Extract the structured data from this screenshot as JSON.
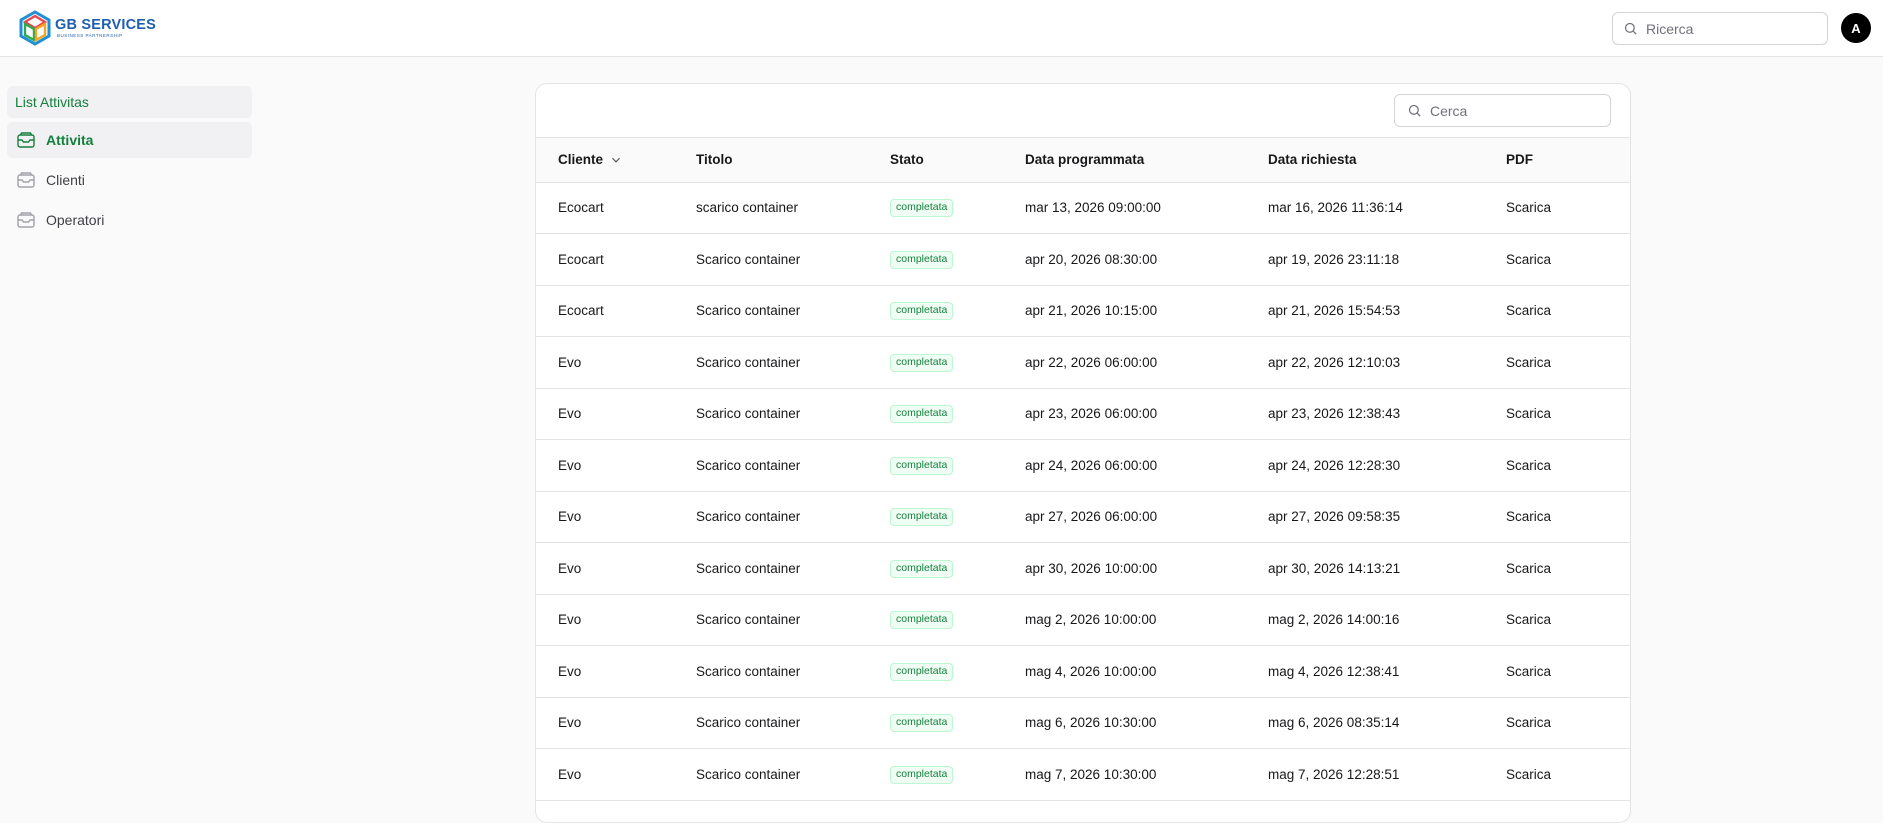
{
  "header": {
    "logo_title": "GB SERVICES",
    "logo_subtitle": "BUSINESS PARTNERSHIP",
    "search_placeholder": "Ricerca",
    "avatar_initial": "A"
  },
  "sidebar": {
    "heading": "List Attivitas",
    "items": [
      {
        "label": "Attivita",
        "active": true
      },
      {
        "label": "Clienti",
        "active": false
      },
      {
        "label": "Operatori",
        "active": false
      }
    ]
  },
  "table": {
    "search_placeholder": "Cerca",
    "columns": [
      "Cliente",
      "Titolo",
      "Stato",
      "Data programmata",
      "Data richiesta",
      "PDF"
    ],
    "rows": [
      {
        "cliente": "Ecocart",
        "titolo": "scarico container",
        "stato": "completata",
        "data_programmata": "mar 13, 2026 09:00:00",
        "data_richiesta": "mar 16, 2026 11:36:14",
        "pdf": "Scarica"
      },
      {
        "cliente": "Ecocart",
        "titolo": "Scarico container",
        "stato": "completata",
        "data_programmata": "apr 20, 2026 08:30:00",
        "data_richiesta": "apr 19, 2026 23:11:18",
        "pdf": "Scarica"
      },
      {
        "cliente": "Ecocart",
        "titolo": "Scarico container",
        "stato": "completata",
        "data_programmata": "apr 21, 2026 10:15:00",
        "data_richiesta": "apr 21, 2026 15:54:53",
        "pdf": "Scarica"
      },
      {
        "cliente": "Evo",
        "titolo": "Scarico container",
        "stato": "completata",
        "data_programmata": "apr 22, 2026 06:00:00",
        "data_richiesta": "apr 22, 2026 12:10:03",
        "pdf": "Scarica"
      },
      {
        "cliente": "Evo",
        "titolo": "Scarico container",
        "stato": "completata",
        "data_programmata": "apr 23, 2026 06:00:00",
        "data_richiesta": "apr 23, 2026 12:38:43",
        "pdf": "Scarica"
      },
      {
        "cliente": "Evo",
        "titolo": "Scarico container",
        "stato": "completata",
        "data_programmata": "apr 24, 2026 06:00:00",
        "data_richiesta": "apr 24, 2026 12:28:30",
        "pdf": "Scarica"
      },
      {
        "cliente": "Evo",
        "titolo": "Scarico container",
        "stato": "completata",
        "data_programmata": "apr 27, 2026 06:00:00",
        "data_richiesta": "apr 27, 2026 09:58:35",
        "pdf": "Scarica"
      },
      {
        "cliente": "Evo",
        "titolo": "Scarico container",
        "stato": "completata",
        "data_programmata": "apr 30, 2026 10:00:00",
        "data_richiesta": "apr 30, 2026 14:13:21",
        "pdf": "Scarica"
      },
      {
        "cliente": "Evo",
        "titolo": "Scarico container",
        "stato": "completata",
        "data_programmata": "mag 2, 2026 10:00:00",
        "data_richiesta": "mag 2, 2026 14:00:16",
        "pdf": "Scarica"
      },
      {
        "cliente": "Evo",
        "titolo": "Scarico container",
        "stato": "completata",
        "data_programmata": "mag 4, 2026 10:00:00",
        "data_richiesta": "mag 4, 2026 12:38:41",
        "pdf": "Scarica"
      },
      {
        "cliente": "Evo",
        "titolo": "Scarico container",
        "stato": "completata",
        "data_programmata": "mag 6, 2026 10:30:00",
        "data_richiesta": "mag 6, 2026 08:35:14",
        "pdf": "Scarica"
      },
      {
        "cliente": "Evo",
        "titolo": "Scarico container",
        "stato": "completata",
        "data_programmata": "mag 7, 2026 10:30:00",
        "data_richiesta": "mag 7, 2026 12:28:51",
        "pdf": "Scarica"
      }
    ]
  },
  "colors": {
    "accent": "#15803d",
    "brand": "#1f5fb0"
  },
  "icons": [
    "logo-icon",
    "search-icon",
    "inbox-icon",
    "chevron-down-icon"
  ]
}
